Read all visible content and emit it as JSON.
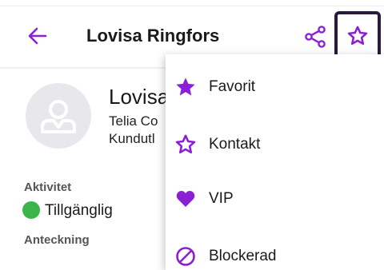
{
  "header": {
    "title": "Lovisa Ringfors",
    "icons": {
      "back": "arrow-left-icon",
      "share": "share-icon",
      "favorite": "star-outline-icon"
    }
  },
  "contact": {
    "name": "Lovisa",
    "company": "Telia Co",
    "role": "Kundutl"
  },
  "details": {
    "activity_label": "Aktivitet",
    "activity_value": "Tillgänglig",
    "note_label": "Anteckning"
  },
  "menu": {
    "items": [
      {
        "label": "Favorit",
        "icon": "star-filled-icon"
      },
      {
        "label": "Kontakt",
        "icon": "star-outline-icon"
      },
      {
        "label": "VIP",
        "icon": "heart-icon"
      },
      {
        "label": "Blockerad",
        "icon": "block-icon"
      }
    ]
  },
  "colors": {
    "accent": "#8a1fd6",
    "status_available": "#39b54a",
    "highlight_border": "#2b1a3d"
  }
}
